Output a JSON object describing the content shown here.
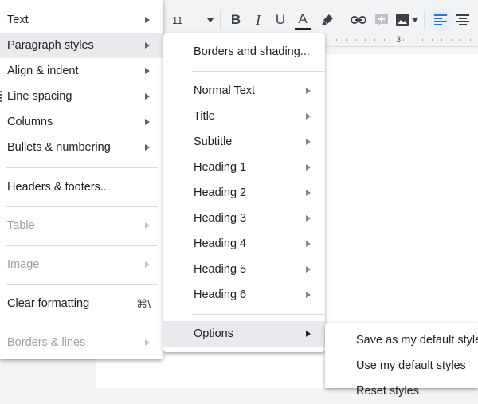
{
  "toolbar": {
    "font_size": "11",
    "bold": "B",
    "italic": "I",
    "underline": "U",
    "text_color_label": "A",
    "icons": [
      "chevron-down-icon",
      "highlighter-icon",
      "link-icon",
      "add-comment-icon",
      "image-icon",
      "align-left-icon",
      "align-center-icon"
    ]
  },
  "ruler": {
    "mark": "3"
  },
  "main_menu": {
    "items": [
      {
        "label": "Text"
      },
      {
        "label": "Paragraph styles"
      },
      {
        "label": "Align & indent"
      },
      {
        "label": "Line spacing"
      },
      {
        "label": "Columns"
      },
      {
        "label": "Bullets & numbering"
      },
      {
        "label": "Headers & footers..."
      },
      {
        "label": "Table"
      },
      {
        "label": "Image"
      },
      {
        "label": "Clear formatting",
        "shortcut": "⌘\\"
      },
      {
        "label": "Borders & lines"
      }
    ]
  },
  "paragraph_styles_menu": {
    "items": [
      {
        "label": "Borders and shading..."
      },
      {
        "label": "Normal Text"
      },
      {
        "label": "Title"
      },
      {
        "label": "Subtitle"
      },
      {
        "label": "Heading 1"
      },
      {
        "label": "Heading 2"
      },
      {
        "label": "Heading 3"
      },
      {
        "label": "Heading 4"
      },
      {
        "label": "Heading 5"
      },
      {
        "label": "Heading 6"
      },
      {
        "label": "Options"
      }
    ]
  },
  "options_menu": {
    "items": [
      {
        "label": "Save as my default styles"
      },
      {
        "label": "Use my default styles"
      },
      {
        "label": "Reset styles"
      }
    ]
  },
  "colors": {
    "accent": "#1a73e8",
    "hover": "#e8eaed",
    "disabled_text": "#9aa0a6"
  }
}
